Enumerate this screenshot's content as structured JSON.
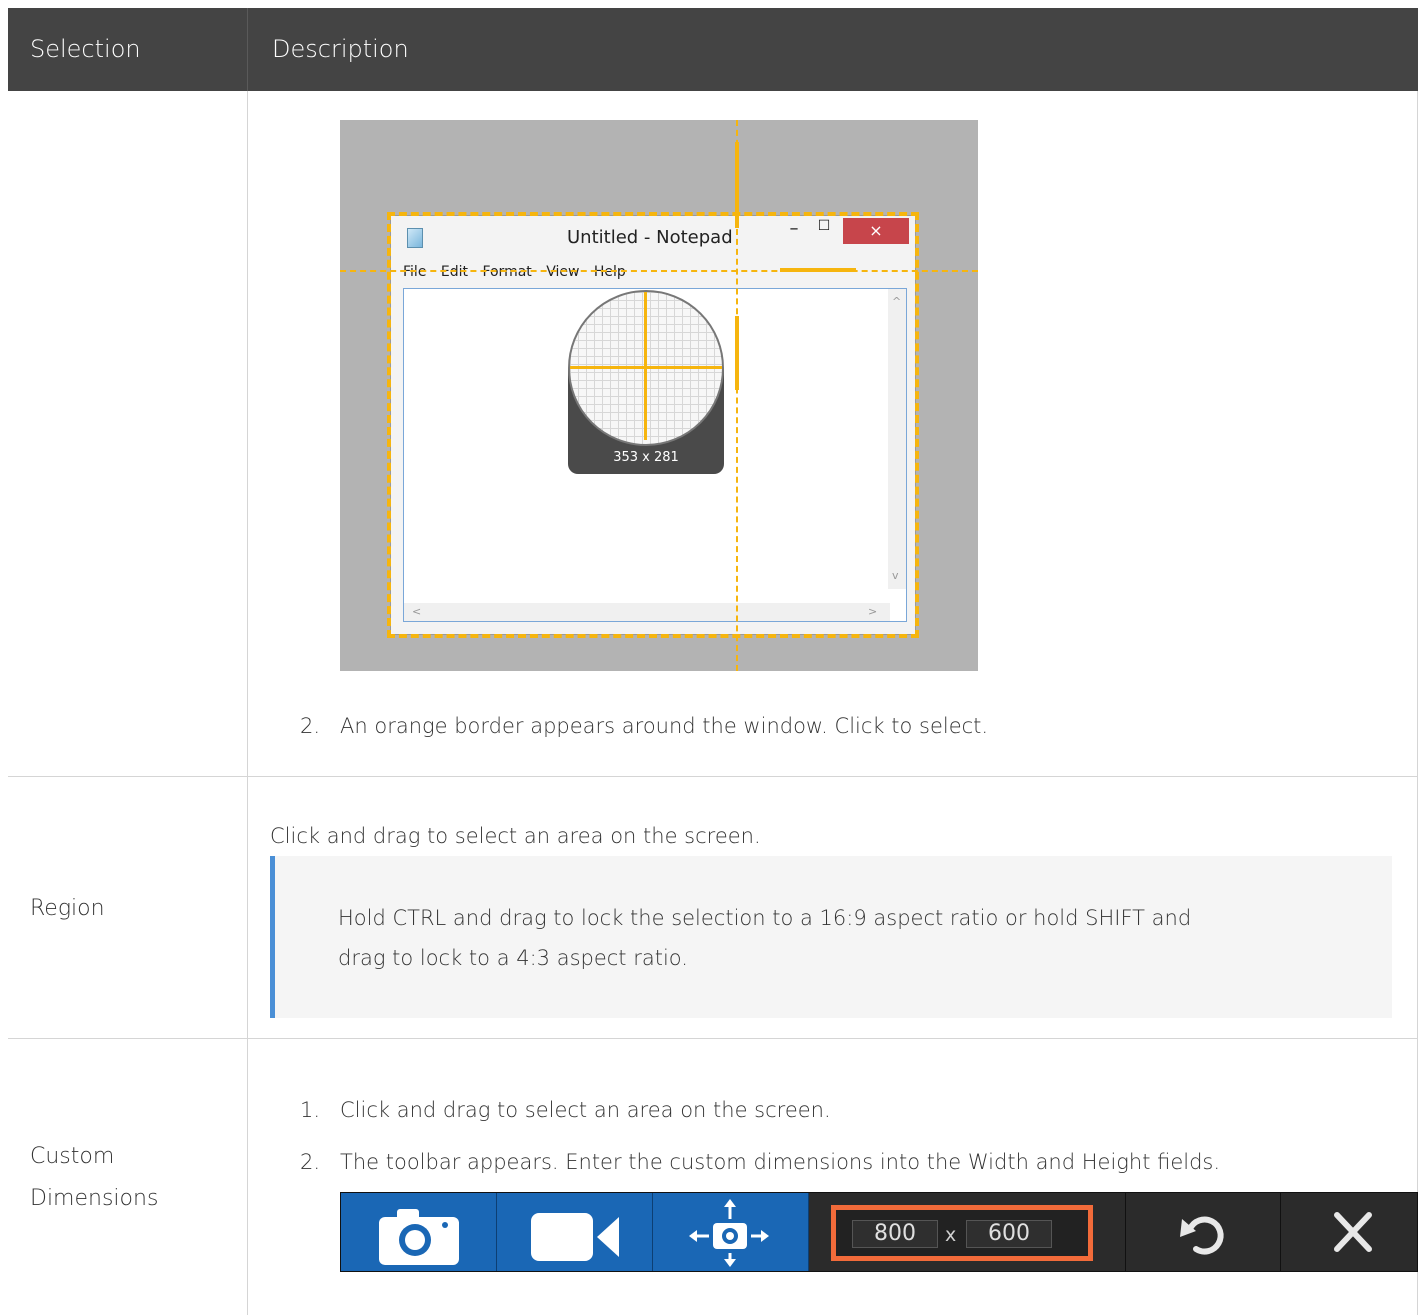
{
  "header": {
    "selection_label": "Selection",
    "description_label": "Description"
  },
  "rows": {
    "window": {
      "step2_number": "2.",
      "step2_text": "An orange border appears around the window. Click to select.",
      "illustration": {
        "notepad_title": "Untitled - Notepad",
        "menu_items": "File Edit Format View Help",
        "min_glyph": "–",
        "max_glyph": "☐",
        "close_glyph": "×",
        "magnifier_readout": "353 x 281"
      }
    },
    "region": {
      "label": "Region",
      "text": "Click and drag to select an area on the screen.",
      "note_line1": "Hold CTRL and drag to lock the selection to a 16:9 aspect ratio or hold SHIFT and",
      "note_line2": "drag to lock to a 4:3 aspect ratio."
    },
    "custom_dimensions": {
      "label_line1": "Custom",
      "label_line2": "Dimensions",
      "step1_number": "1.",
      "step1_text": "Click and drag to select an area on the screen.",
      "step2_number": "2.",
      "step2_text": "The toolbar appears. Enter the custom dimensions into the Width and Height fields.",
      "toolbar": {
        "width_value": "800",
        "times_glyph": "x",
        "height_value": "600",
        "icons": [
          "camera-icon",
          "video-camera-icon",
          "move-camera-icon",
          "redo-icon",
          "close-icon"
        ]
      }
    }
  },
  "colors": {
    "header_bg": "#444444",
    "selection_orange": "#f6b50e",
    "note_accent": "#4a8fd6",
    "toolbar_blue": "#1a67b5",
    "dimension_outline": "#f26b3a"
  }
}
